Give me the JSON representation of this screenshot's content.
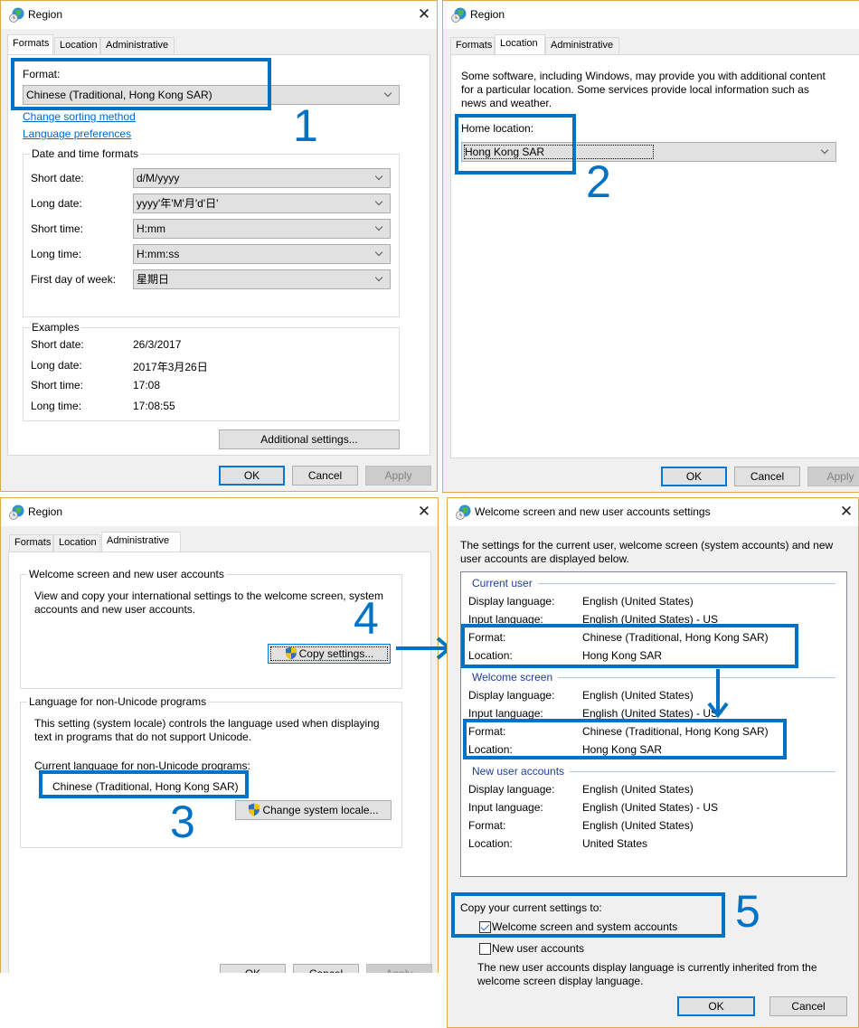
{
  "colors": {
    "annotation": "#0072c6",
    "dialog_border": "#e1a650",
    "link": "#0066cc",
    "section_title": "#1f3c99"
  },
  "icons": {
    "title": "globe-clock-icon",
    "close": "close-icon",
    "chevron": "chevron-down-icon",
    "uac": "uac-shield-icon",
    "arrow": "arrow-icon"
  },
  "dialog1": {
    "title": "Region",
    "close_glyph": "✕",
    "tabs": [
      "Formats",
      "Location",
      "Administrative"
    ],
    "active_tab": "Formats",
    "format_label": "Format:",
    "format_value": "Chinese (Traditional, Hong Kong SAR)",
    "links": {
      "sorting": "Change sorting method",
      "language_prefs": "Language preferences"
    },
    "date_time_group": {
      "title": "Date and time formats",
      "rows": [
        {
          "label": "Short date:",
          "value": "d/M/yyyy"
        },
        {
          "label": "Long date:",
          "value": "yyyy'年'M'月'd'日'"
        },
        {
          "label": "Short time:",
          "value": "H:mm"
        },
        {
          "label": "Long time:",
          "value": "H:mm:ss"
        },
        {
          "label": "First day of week:",
          "value": "星期日"
        }
      ]
    },
    "examples_group": {
      "title": "Examples",
      "rows": [
        {
          "label": "Short date:",
          "value": "26/3/2017"
        },
        {
          "label": "Long date:",
          "value": "2017年3月26日"
        },
        {
          "label": "Short time:",
          "value": "17:08"
        },
        {
          "label": "Long time:",
          "value": "17:08:55"
        }
      ]
    },
    "additional_settings": "Additional settings...",
    "buttons": {
      "ok": "OK",
      "cancel": "Cancel",
      "apply": "Apply"
    },
    "annotation": "1"
  },
  "dialog2": {
    "title": "Region",
    "tabs": [
      "Formats",
      "Location",
      "Administrative"
    ],
    "active_tab": "Location",
    "description": "Some software, including Windows, may provide you with additional content for a particular location. Some services provide local information such as news and weather.",
    "home_location_label": "Home location:",
    "home_location_value": "Hong Kong SAR",
    "buttons": {
      "ok": "OK",
      "cancel": "Cancel",
      "apply": "Apply"
    },
    "annotation": "2"
  },
  "dialog3": {
    "title": "Region",
    "close_glyph": "✕",
    "tabs": [
      "Formats",
      "Location",
      "Administrative"
    ],
    "active_tab": "Administrative",
    "welcome_group": {
      "title": "Welcome screen and new user accounts",
      "description": "View and copy your international settings to the welcome screen, system accounts and new user accounts.",
      "copy_button": "Copy settings..."
    },
    "unicode_group": {
      "title": "Language for non-Unicode programs",
      "description": "This setting (system locale) controls the language used when displaying text in programs that do not support Unicode.",
      "current_label": "Current language for non-Unicode programs:",
      "current_value": "Chinese (Traditional, Hong Kong SAR)",
      "change_button": "Change system locale..."
    },
    "buttons": {
      "ok": "OK",
      "cancel": "Cancel",
      "apply": "Apply"
    },
    "annotation_locale": "3",
    "annotation_copy": "4"
  },
  "dialog4": {
    "title": "Welcome screen and new user accounts settings",
    "close_glyph": "✕",
    "intro": "The settings for the current user, welcome screen (system accounts) and new user accounts are displayed below.",
    "sections": [
      {
        "title": "Current user",
        "rows": [
          {
            "label": "Display language:",
            "value": "English (United States)"
          },
          {
            "label": "Input language:",
            "value": "English (United States) - US"
          },
          {
            "label": "Format:",
            "value": "Chinese (Traditional, Hong Kong SAR)"
          },
          {
            "label": "Location:",
            "value": "Hong Kong SAR"
          }
        ]
      },
      {
        "title": "Welcome screen",
        "rows": [
          {
            "label": "Display language:",
            "value": "English (United States)"
          },
          {
            "label": "Input language:",
            "value": "English (United States) - US"
          },
          {
            "label": "Format:",
            "value": "Chinese (Traditional, Hong Kong SAR)"
          },
          {
            "label": "Location:",
            "value": "Hong Kong SAR"
          }
        ]
      },
      {
        "title": "New user accounts",
        "rows": [
          {
            "label": "Display language:",
            "value": "English (United States)"
          },
          {
            "label": "Input language:",
            "value": "English (United States) - US"
          },
          {
            "label": "Format:",
            "value": "English (United States)"
          },
          {
            "label": "Location:",
            "value": "United States"
          }
        ]
      }
    ],
    "copy_to_label": "Copy your current settings to:",
    "checkbox_welcome": {
      "label": "Welcome screen and system accounts",
      "checked": true
    },
    "checkbox_new_users": {
      "label": "New user accounts",
      "checked": false
    },
    "note": "The new user accounts display language is currently inherited from the welcome screen display language.",
    "buttons": {
      "ok": "OK",
      "cancel": "Cancel"
    },
    "annotation": "5"
  }
}
